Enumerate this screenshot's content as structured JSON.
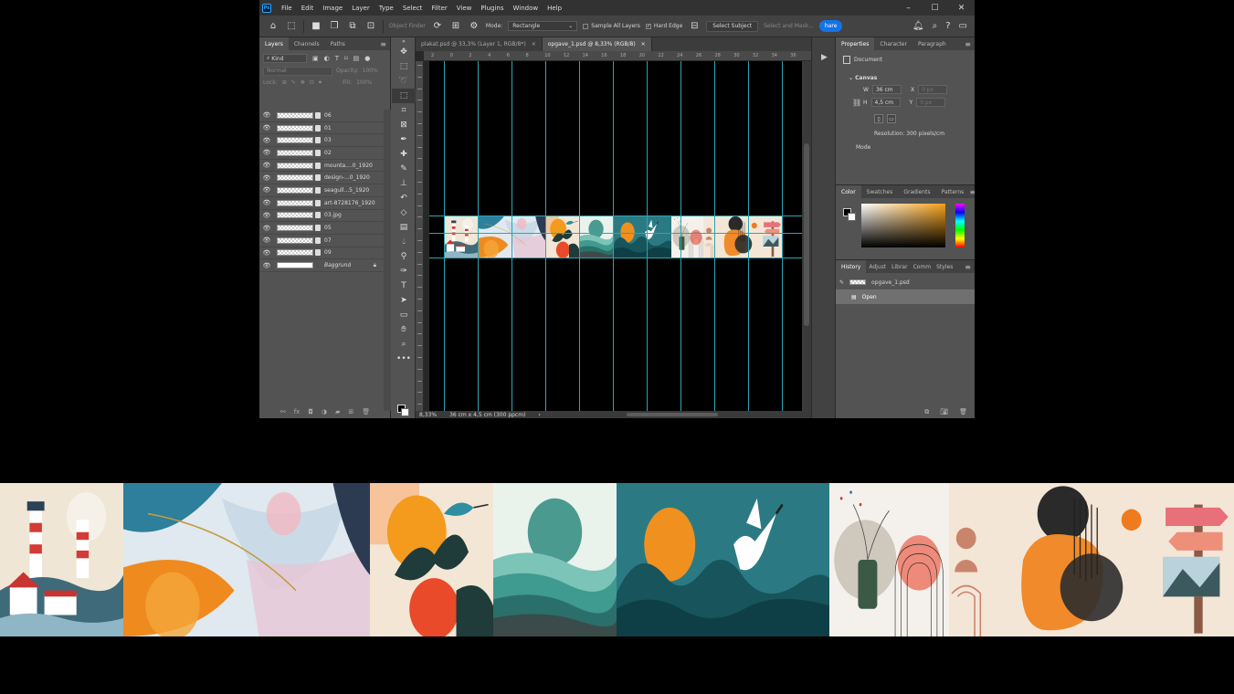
{
  "menubar": {
    "items": [
      "File",
      "Edit",
      "Image",
      "Layer",
      "Type",
      "Select",
      "Filter",
      "View",
      "Plugins",
      "Window",
      "Help"
    ],
    "ps_logo": "Ps"
  },
  "options": {
    "object_finder": "Object Finder",
    "mode_label": "Mode:",
    "mode_value": "Rectangle",
    "sample_all": "Sample All Layers",
    "hard_edge": "Hard Edge",
    "select_subject": "Select Subject",
    "select_mask": "Select and Mask...",
    "share": "hare"
  },
  "layers_panel": {
    "tabs": [
      "Layers",
      "Channels",
      "Paths"
    ],
    "kind_label": "Kind",
    "blend_mode": "Normal",
    "opacity_label": "Opacity:",
    "opacity_value": "100%",
    "lock_label": "Lock:",
    "fill_label": "Fill:",
    "fill_value": "100%",
    "layers": [
      {
        "name": "06"
      },
      {
        "name": "01"
      },
      {
        "name": "03"
      },
      {
        "name": "02"
      },
      {
        "name": "mounta....0_1920"
      },
      {
        "name": "design-...0_1920"
      },
      {
        "name": "seagull...5_1920"
      },
      {
        "name": "art-8728176_1920"
      },
      {
        "name": "03.jpg"
      },
      {
        "name": "05"
      },
      {
        "name": "07"
      },
      {
        "name": "09"
      },
      {
        "name": "Baggrund"
      }
    ]
  },
  "document": {
    "tabs": [
      {
        "label": "plakat.psd @ 33,3% (Layer 1, RGB/8*)"
      },
      {
        "label": "opgave_1.psd @ 8,33% (RGB/8)"
      }
    ],
    "ruler_top": [
      "2",
      "0",
      "2",
      "4",
      "6",
      "8",
      "10",
      "12",
      "14",
      "16",
      "18",
      "20",
      "22",
      "24",
      "26",
      "28",
      "30",
      "32",
      "34",
      "36"
    ],
    "zoom": "8,33%",
    "doc_size": "36 cm x 4,5 cm (300 ppcm)"
  },
  "properties": {
    "tabs": [
      "Properties",
      "Character",
      "Paragraph"
    ],
    "doc_label": "Document",
    "canvas_title": "Canvas",
    "w_label": "W",
    "w_value": "36 cm",
    "h_label": "H",
    "h_value": "4,5 cm",
    "x_label": "X",
    "x_value": "0 px",
    "y_label": "Y",
    "y_value": "0 px",
    "resolution": "Resolution: 300 pixels/cm",
    "mode_label": "Mode"
  },
  "color_panel": {
    "tabs": [
      "Color",
      "Swatches",
      "Gradients",
      "Patterns"
    ]
  },
  "history_panel": {
    "tabs": [
      "History",
      "Adjust",
      "Librar",
      "Comm",
      "Styles"
    ],
    "items": [
      {
        "label": "opgave_1.psd"
      },
      {
        "label": "Open"
      }
    ]
  },
  "colors": {
    "guide": "#2aa6b4",
    "teal": "#2b7a83",
    "orange": "#f0901e",
    "accent": "#1473e6"
  }
}
